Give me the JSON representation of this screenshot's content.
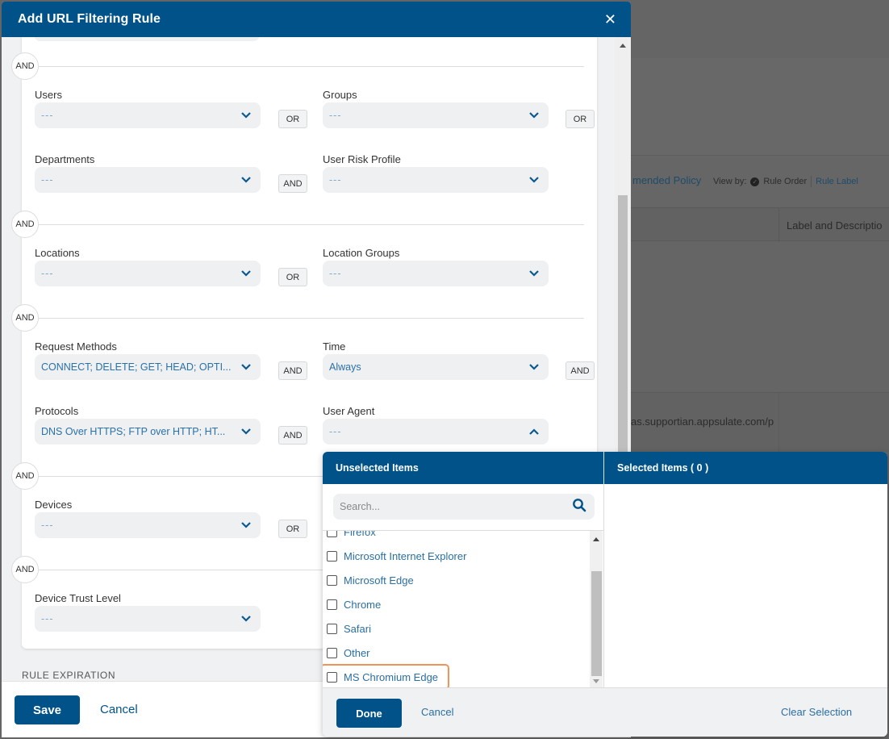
{
  "background": {
    "toolbar": {
      "recommended_policy_partial": "mended Policy",
      "view_by_label": "View by:",
      "view_by_options": [
        "Rule Order",
        "Rule Label"
      ],
      "view_by_selected": "Rule Order"
    },
    "table": {
      "column_header_partial": "Label and Descriptio",
      "row_url_partial": "as.supportian.appsulate.com/p"
    }
  },
  "modal": {
    "title": "Add URL Filtering Rule",
    "close_icon": "close-icon",
    "group_operators": [
      "AND",
      "AND",
      "AND",
      "AND",
      "AND"
    ],
    "fields": {
      "users": {
        "label": "Users",
        "value": "---",
        "operator": "OR"
      },
      "groups": {
        "label": "Groups",
        "value": "---",
        "operator": "OR"
      },
      "departments": {
        "label": "Departments",
        "value": "---",
        "operator": "AND"
      },
      "user_risk_profile": {
        "label": "User Risk Profile",
        "value": "---"
      },
      "locations": {
        "label": "Locations",
        "value": "---",
        "operator": "OR"
      },
      "location_groups": {
        "label": "Location Groups",
        "value": "---"
      },
      "request_methods": {
        "label": "Request Methods",
        "value": "CONNECT; DELETE; GET; HEAD; OPTI...",
        "operator": "AND"
      },
      "time": {
        "label": "Time",
        "value": "Always",
        "operator": "AND"
      },
      "protocols": {
        "label": "Protocols",
        "value": "DNS Over HTTPS; FTP over HTTP; HT...",
        "operator": "AND"
      },
      "user_agent": {
        "label": "User Agent",
        "value": "---",
        "expanded": true
      },
      "devices": {
        "label": "Devices",
        "value": "---",
        "operator": "OR"
      },
      "device_trust_level": {
        "label": "Device Trust Level",
        "value": "---"
      }
    },
    "section_rule_expiration": "RULE EXPIRATION",
    "footer": {
      "save_label": "Save",
      "cancel_label": "Cancel"
    }
  },
  "user_agent_dropdown": {
    "unselected_header": "Unselected Items",
    "selected_header": "Selected Items ( 0 )",
    "selected_count": 0,
    "search_placeholder": "Search...",
    "search_value": "",
    "items": [
      {
        "label": "Firefox",
        "checked": false
      },
      {
        "label": "Microsoft Internet Explorer",
        "checked": false
      },
      {
        "label": "Microsoft Edge",
        "checked": false
      },
      {
        "label": "Chrome",
        "checked": false
      },
      {
        "label": "Safari",
        "checked": false
      },
      {
        "label": "Other",
        "checked": false
      },
      {
        "label": "MS Chromium Edge",
        "checked": false,
        "highlighted": true
      }
    ],
    "selected_items": [],
    "done_label": "Done",
    "cancel_label": "Cancel",
    "clear_label": "Clear Selection"
  },
  "colors": {
    "brand": "#005289",
    "link": "#2a6fa3",
    "highlight_outline": "#f0945a",
    "overlay": "#656565"
  }
}
